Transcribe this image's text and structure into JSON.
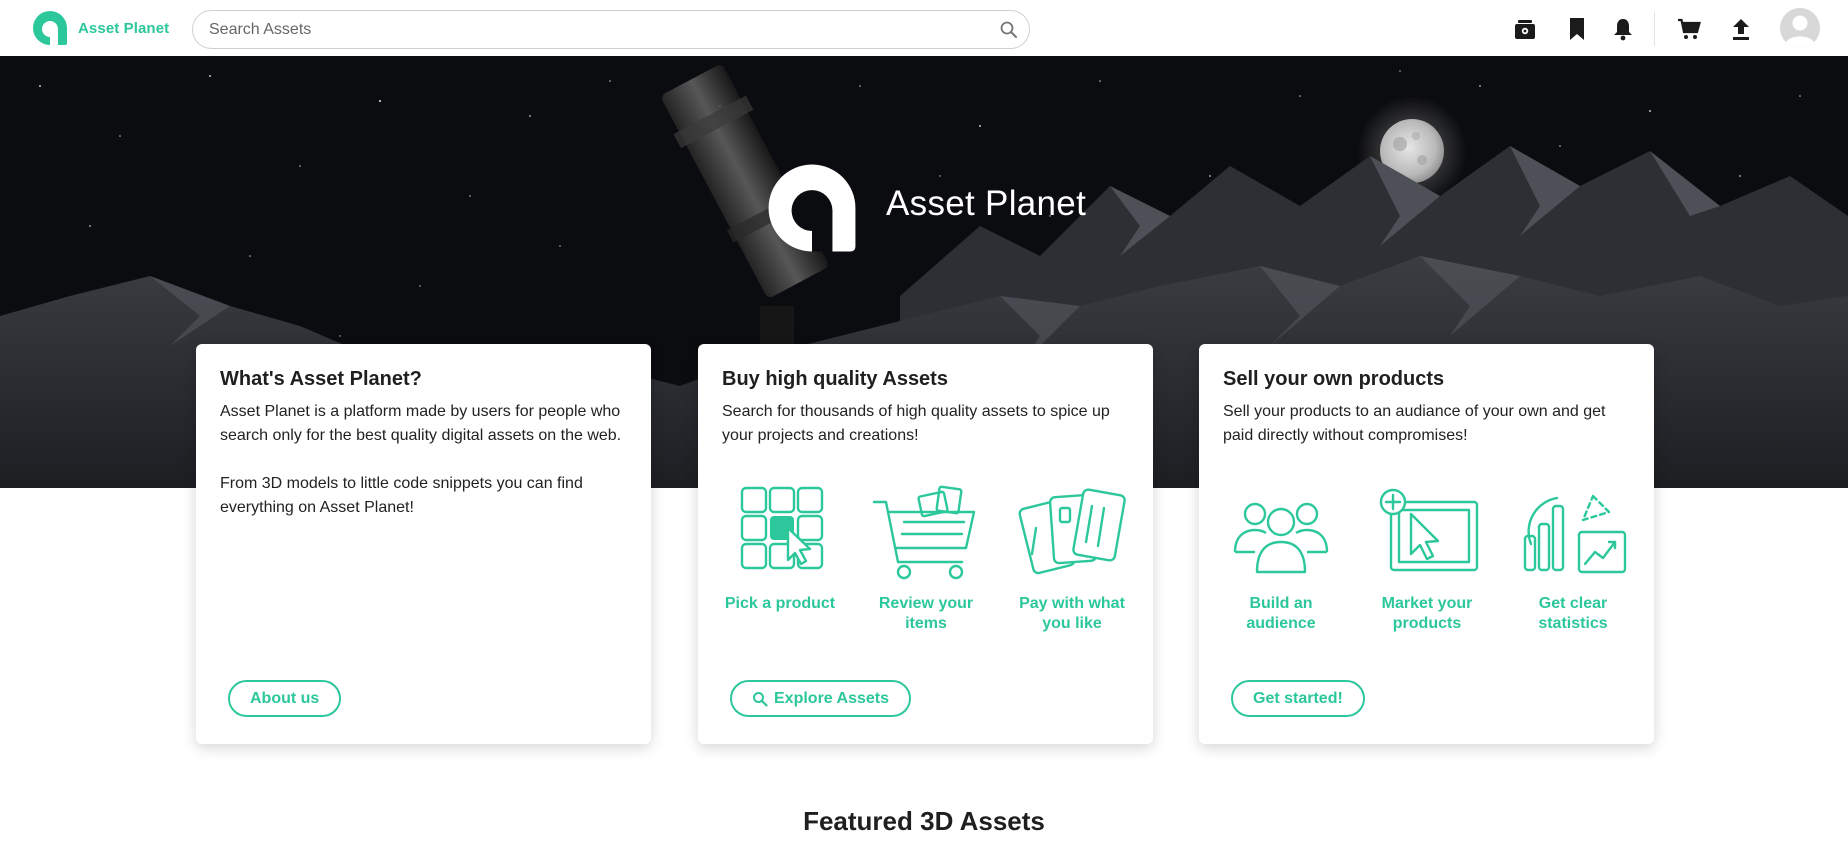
{
  "header": {
    "brand_name": "Asset Planet",
    "search_placeholder": "Search Assets",
    "icons": [
      "library-icon",
      "bookmark-icon",
      "bell-icon",
      "cart-icon",
      "upload-icon",
      "avatar"
    ]
  },
  "hero": {
    "title": "Asset Planet"
  },
  "cards": [
    {
      "title": "What's Asset Planet?",
      "paragraphs": [
        "Asset Planet is a platform made by users for people who search only for the best quality digital assets on the web.",
        "From 3D models to little code snippets you can find everything on Asset Planet!"
      ],
      "button": "About us"
    },
    {
      "title": "Buy high quality Assets",
      "paragraphs": [
        "Search for thousands of high quality assets to spice up your projects and creations!"
      ],
      "features": [
        {
          "label": "Pick a product",
          "icon": "grid-cursor-icon"
        },
        {
          "label": "Review your items",
          "icon": "shopping-cart-icon"
        },
        {
          "label": "Pay with what you like",
          "icon": "payment-cards-icon"
        }
      ],
      "button": "Explore Assets"
    },
    {
      "title": "Sell your own products",
      "paragraphs": [
        "Sell your products to an audiance of your own and get paid directly without compromises!"
      ],
      "features": [
        {
          "label": "Build an audience",
          "icon": "people-group-icon"
        },
        {
          "label": "Market your products",
          "icon": "screen-cursor-icon"
        },
        {
          "label": "Get clear statistics",
          "icon": "statistics-chart-icon"
        }
      ],
      "button": "Get started!"
    }
  ],
  "featured": {
    "title": "Featured 3D Assets"
  },
  "colors": {
    "accent": "#2cc79b",
    "hero_bg": "#0c0d10",
    "text": "#1f1f1f"
  }
}
